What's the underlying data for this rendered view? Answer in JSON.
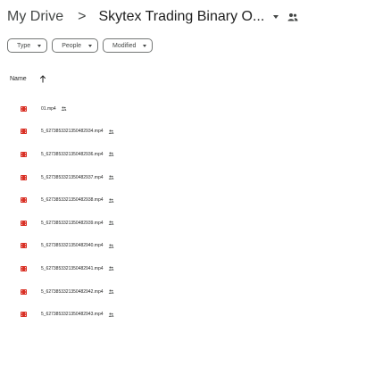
{
  "breadcrumb": {
    "root": "My Drive",
    "separator": ">",
    "current": "Skytex Trading Binary O..."
  },
  "filters": [
    {
      "label": "Type"
    },
    {
      "label": "People"
    },
    {
      "label": "Modified"
    }
  ],
  "columns": {
    "name": "Name"
  },
  "files": [
    {
      "name": "01.mp4",
      "icon": "video-file-icon",
      "shared": true
    },
    {
      "name": "5_6273853321350482934.mp4",
      "icon": "video-file-icon",
      "shared": true
    },
    {
      "name": "5_6273853321350482936.mp4",
      "icon": "video-file-icon",
      "shared": true
    },
    {
      "name": "5_6273853321350482937.mp4",
      "icon": "video-file-icon",
      "shared": true
    },
    {
      "name": "5_6273853321350482938.mp4",
      "icon": "video-file-icon",
      "shared": true
    },
    {
      "name": "5_6273853321350482939.mp4",
      "icon": "video-file-icon",
      "shared": true
    },
    {
      "name": "5_6273853321350482940.mp4",
      "icon": "video-file-icon",
      "shared": true
    },
    {
      "name": "5_6273853321350482941.mp4",
      "icon": "video-file-icon",
      "shared": true
    },
    {
      "name": "5_6273853321350482942.mp4",
      "icon": "video-file-icon",
      "shared": true
    },
    {
      "name": "5_6273853321350482943.mp4",
      "icon": "video-file-icon",
      "shared": true
    }
  ],
  "colors": {
    "video_icon": "#d93025",
    "text": "#1f1f1f",
    "muted": "#444746",
    "chip_border": "#747775"
  }
}
